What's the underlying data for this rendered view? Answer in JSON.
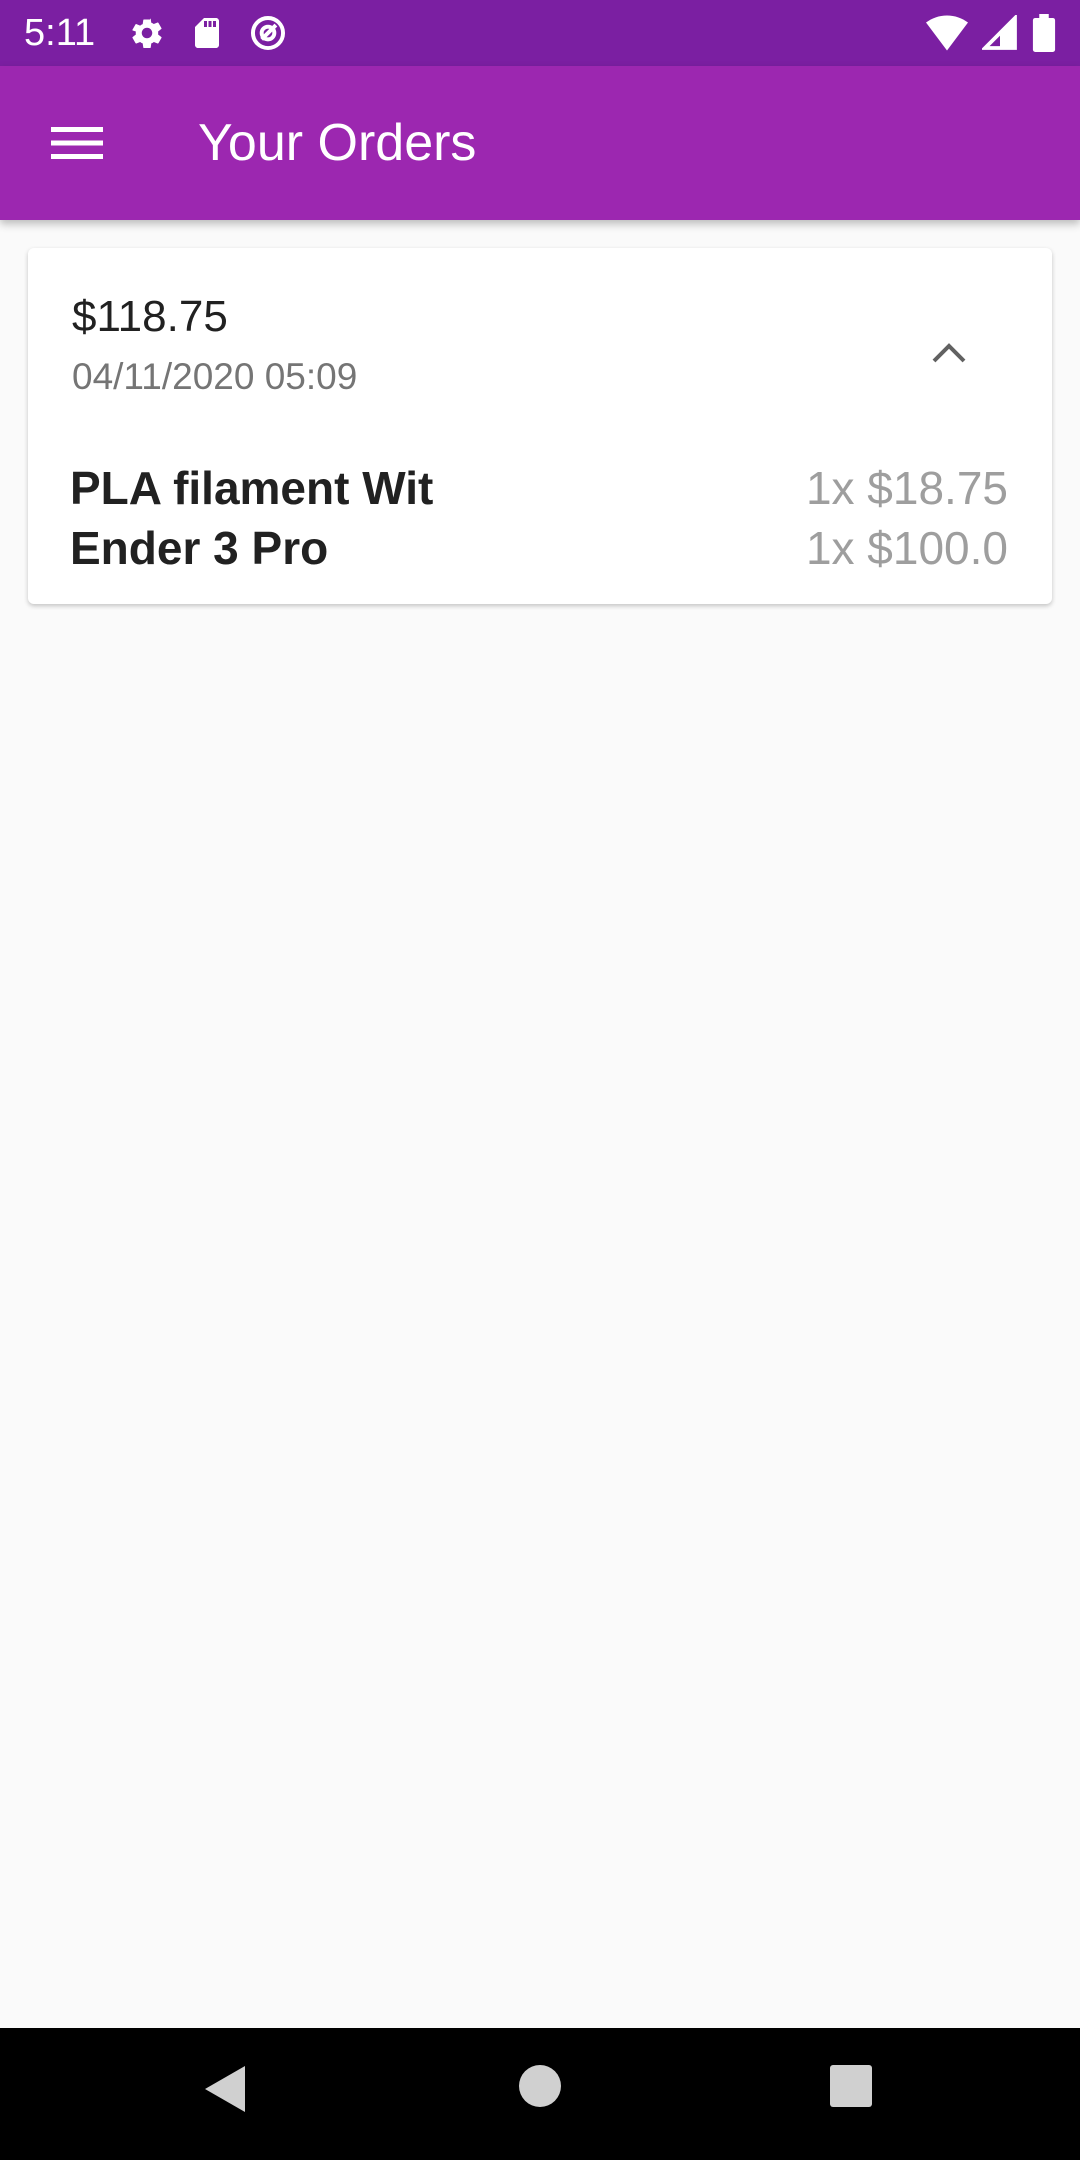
{
  "status_bar": {
    "time": "5:11",
    "left_icons": [
      "gear-icon",
      "sd-card-icon",
      "at-sign-icon"
    ],
    "right_icons": [
      "wifi-icon",
      "signal-icon",
      "battery-icon"
    ]
  },
  "app_bar": {
    "title": "Your Orders",
    "menu_icon": "hamburger-menu-icon",
    "background": "#9c27b0"
  },
  "order": {
    "total": "$118.75",
    "date": "04/11/2020 05:09",
    "expanded": true,
    "items": [
      {
        "name": "PLA filament Wit",
        "qty_price": "1x $18.75"
      },
      {
        "name": "Ender 3 Pro",
        "qty_price": "1x $100.0"
      }
    ]
  },
  "nav_bar": {
    "buttons": [
      "back-icon",
      "home-icon",
      "recents-icon"
    ]
  }
}
